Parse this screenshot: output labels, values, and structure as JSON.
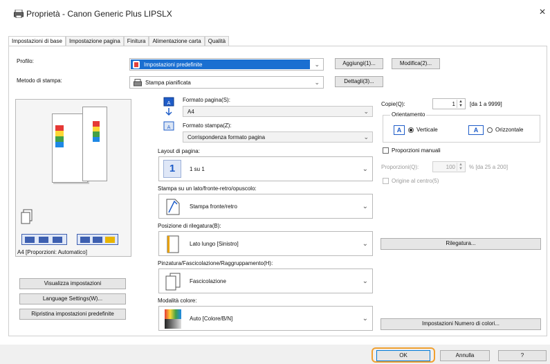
{
  "window": {
    "title": "Proprietà - Canon Generic Plus LIPSLX",
    "close": "×"
  },
  "tabs": [
    "Impostazioni di base",
    "Impostazione pagina",
    "Finitura",
    "Alimentazione carta",
    "Qualità"
  ],
  "profilo": {
    "label": "Profilo:",
    "value": "Impostazioni predefinite",
    "add_button": "Aggiungi(1)...",
    "edit_button": "Modifica(2)..."
  },
  "metodo": {
    "label": "Metodo di stampa:",
    "value": "Stampa pianificata",
    "details_button": "Dettagli(3)..."
  },
  "preview": {
    "caption": "A4 [Proporzioni: Automatico]"
  },
  "left_buttons": {
    "view_settings": "Visualizza impostazioni",
    "language": "Language Settings(W)...",
    "restore": "Ripristina impostazioni predefinite"
  },
  "formato_pagina": {
    "label": "Formato pagina(S):",
    "value": "A4"
  },
  "formato_stampa": {
    "label": "Formato stampa(Z):",
    "value": "Corrispondenza formato pagina"
  },
  "layout": {
    "label": "Layout di pagina:",
    "icon_text": "1",
    "value": "1 su 1"
  },
  "stampa_lato": {
    "label": "Stampa su un lato/fronte-retro/opuscolo:",
    "value": "Stampa fronte/retro"
  },
  "rilegatura": {
    "label": "Posizione di rilegatura(B):",
    "value": "Lato lungo [Sinistro]",
    "button": "Rilegatura..."
  },
  "pinzatura": {
    "label": "Pinzatura/Fascicolazione/Raggruppamento(H):",
    "value": "Fascicolazione"
  },
  "colore": {
    "label": "Modalità colore:",
    "value": "Auto [Colore/B/N]",
    "button": "Impostazioni Numero di colori..."
  },
  "copie": {
    "label": "Copie(Q):",
    "value": "1",
    "range": "[da 1 a 9999]"
  },
  "orientamento": {
    "label": "Orientamento",
    "vertical": "Verticale",
    "horizontal": "Orizzontale",
    "selected": "Verticale"
  },
  "proporzioni": {
    "checkbox_label": "Proporzioni manuali",
    "label": "Proporzioni(Q):",
    "value": "100",
    "range": "% [da 25 a 200]",
    "origin": "Origine al centro(5)"
  },
  "footer": {
    "ok": "OK",
    "cancel": "Annulla",
    "help": "?"
  }
}
